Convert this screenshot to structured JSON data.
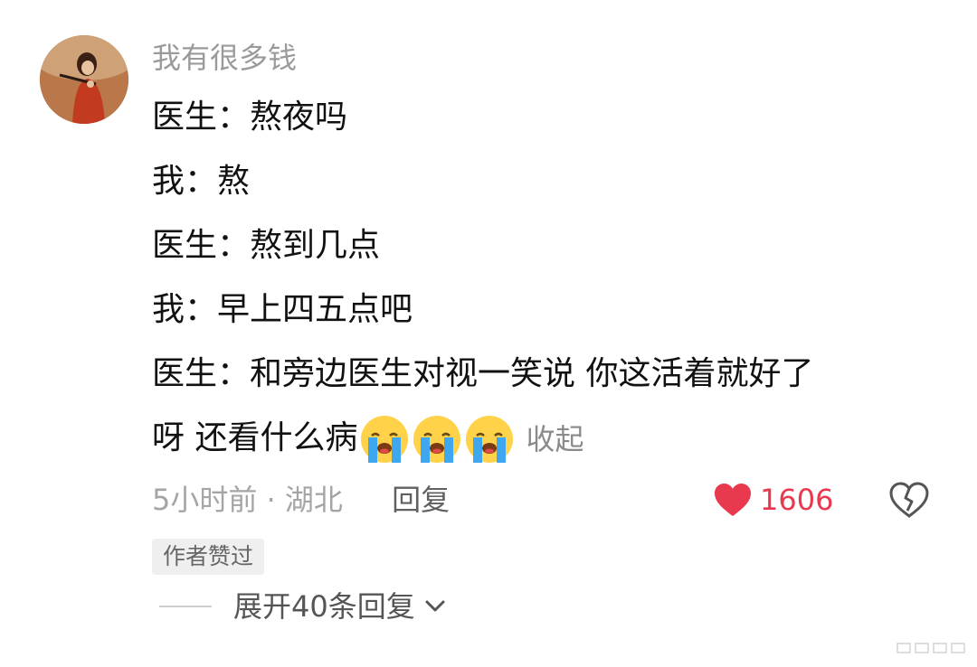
{
  "comment": {
    "username": "我有很多钱",
    "lines": [
      "医生：熬夜吗",
      "我：熬",
      "医生：熬到几点",
      "我：早上四五点吧",
      "医生：和旁边医生对视一笑说 你这活着就好了",
      "呀 还看什么病"
    ],
    "emojis": [
      "loudly-crying-face",
      "loudly-crying-face",
      "loudly-crying-face"
    ],
    "collapse_label": "收起",
    "time": "5小时前",
    "separator": "·",
    "location": "湖北",
    "reply_label": "回复",
    "like_count": "1606",
    "author_liked_badge": "作者赞过",
    "expand_replies_label": "展开40条回复",
    "colors": {
      "like": "#e8394f",
      "username": "#9a9a9a",
      "meta": "#a5a5a5"
    }
  }
}
